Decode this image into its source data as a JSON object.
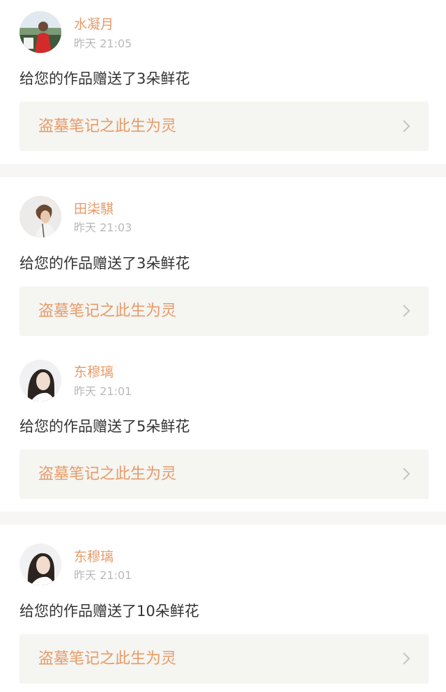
{
  "notifications": [
    {
      "user_name": "水凝月",
      "time": "昨天 21:05",
      "message": "给您的作品赠送了3朵鲜花",
      "work_title": "盗墓笔记之此生为灵",
      "avatar_icon": "user-avatar-outdoor-photo"
    },
    {
      "user_name": "田柒騏",
      "time": "昨天 21:03",
      "message": "给您的作品赠送了3朵鲜花",
      "work_title": "盗墓笔记之此生为灵",
      "avatar_icon": "user-avatar-portrait-photo"
    },
    {
      "user_name": "东穆璃",
      "time": "昨天 21:01",
      "message": "给您的作品赠送了5朵鲜花",
      "work_title": "盗墓笔记之此生为灵",
      "avatar_icon": "user-avatar-portrait-photo"
    },
    {
      "user_name": "东穆璃",
      "time": "昨天 21:01",
      "message": "给您的作品赠送了10朵鲜花",
      "work_title": "盗墓笔记之此生为灵",
      "avatar_icon": "user-avatar-portrait-photo"
    }
  ],
  "colors": {
    "accent": "#e79a68",
    "muted_text": "#b9b9b9",
    "body_text": "#333333",
    "link_bg": "#f5f5f1",
    "divider": "#f7f6f5"
  }
}
